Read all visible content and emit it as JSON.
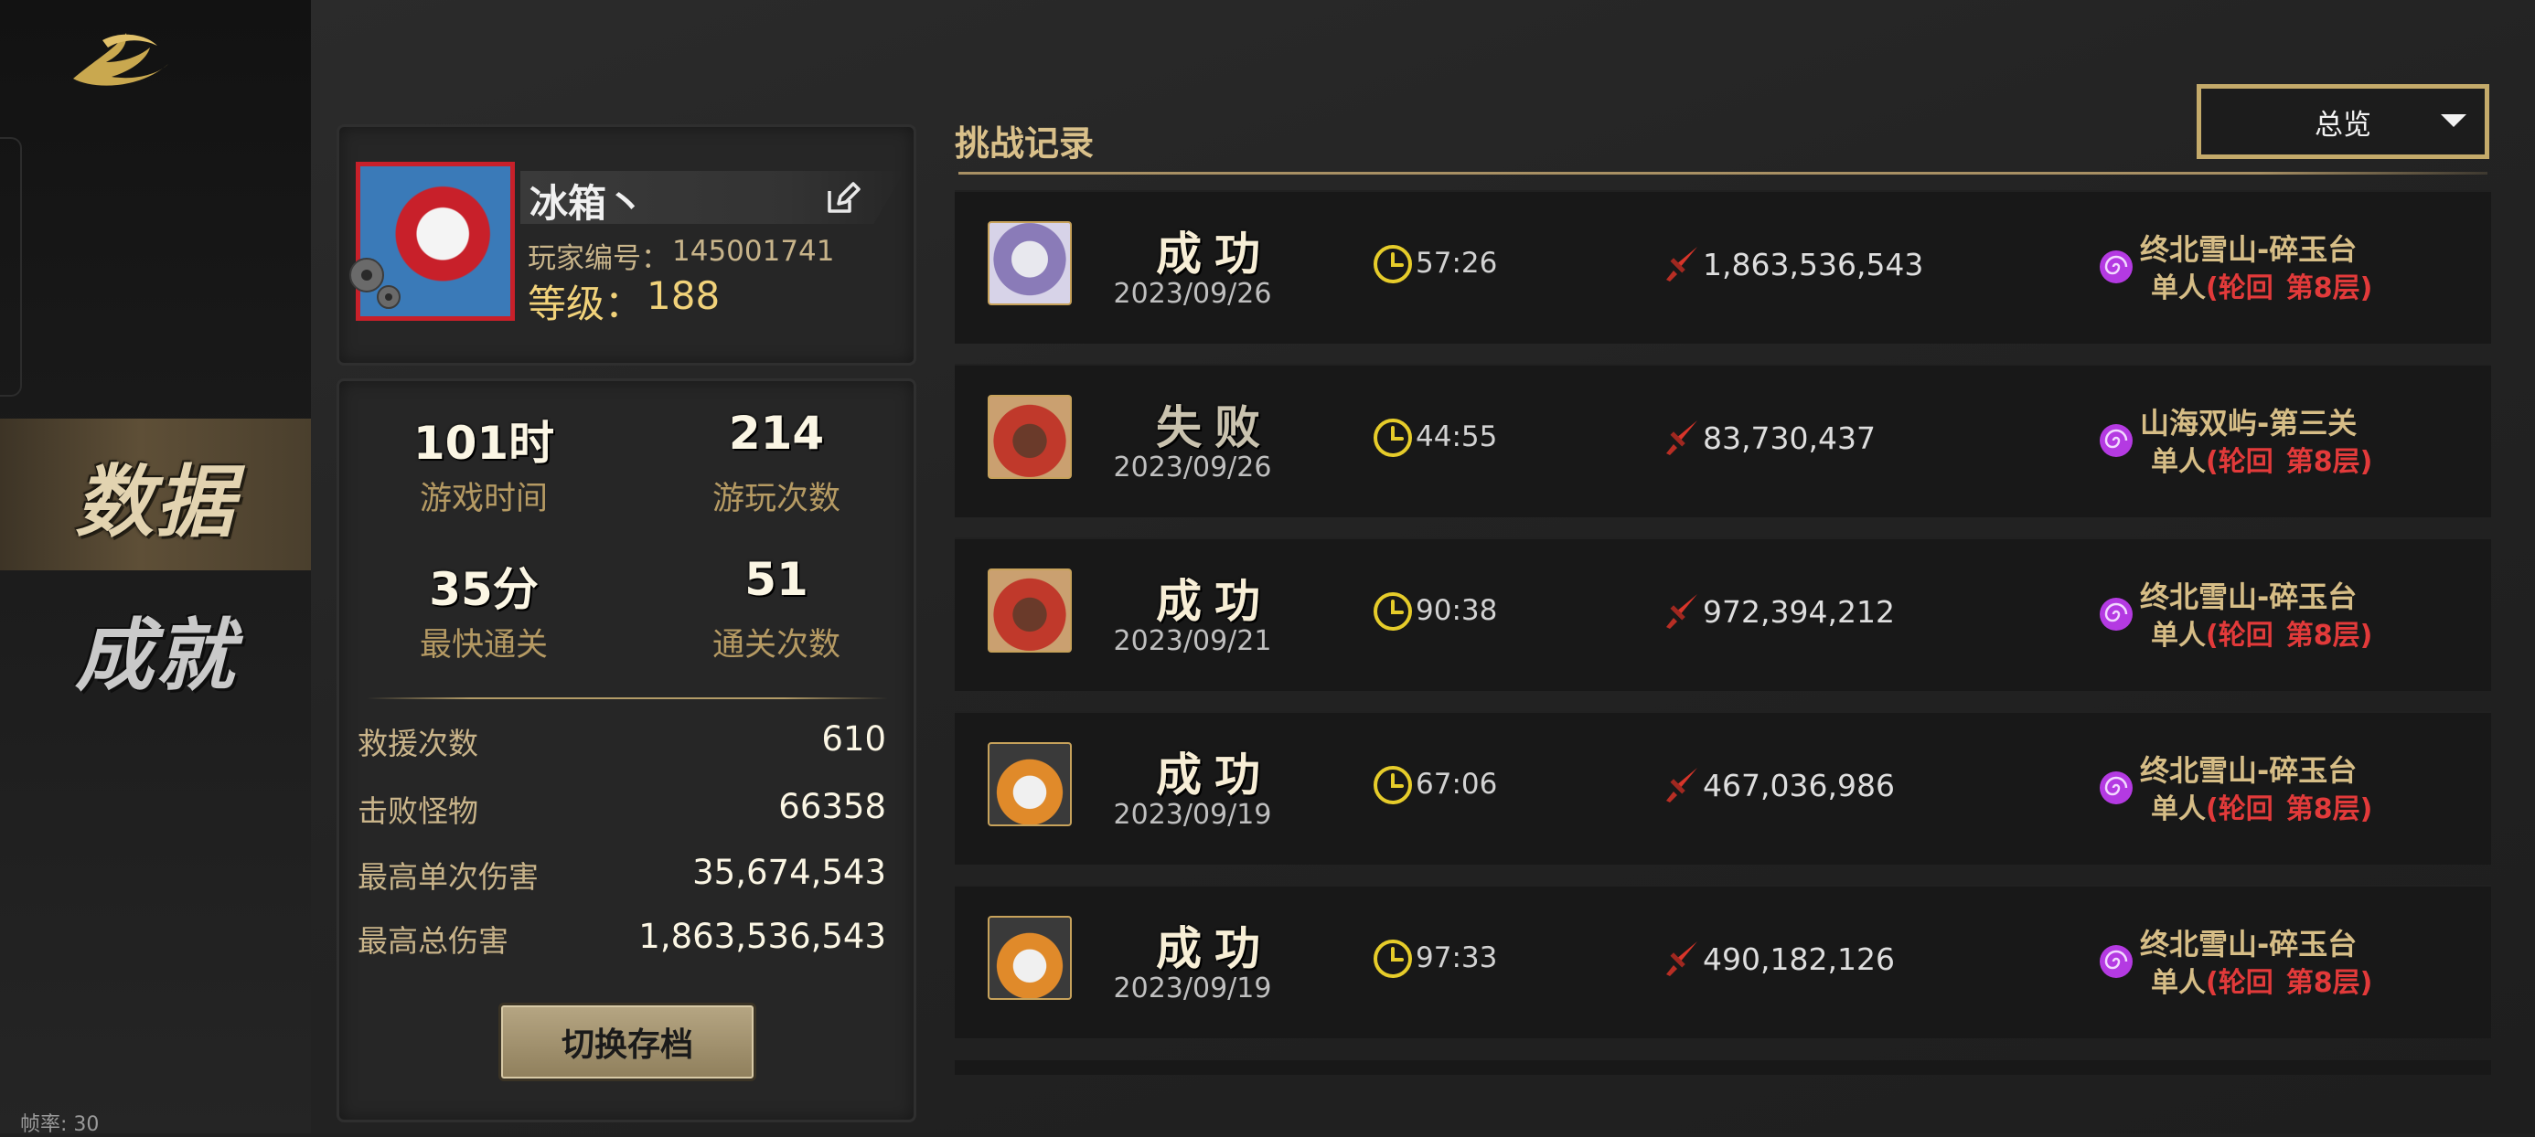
{
  "sidebar": {
    "nav": [
      {
        "label": "数据",
        "active": true
      },
      {
        "label": "成就",
        "active": false
      }
    ],
    "fps": "帧率: 30"
  },
  "profile": {
    "name": "冰箱丶",
    "player_id_label": "玩家编号：",
    "player_id": "145001741",
    "level_label": "等级：",
    "level": "188"
  },
  "stats": {
    "grid": [
      {
        "value": "101时",
        "label": "游戏时间"
      },
      {
        "value": "214",
        "label": "游玩次数"
      },
      {
        "value": "35分",
        "label": "最快通关"
      },
      {
        "value": "51",
        "label": "通关次数"
      }
    ],
    "rows": [
      {
        "label": "救援次数",
        "value": "610"
      },
      {
        "label": "击败怪物",
        "value": "66358"
      },
      {
        "label": "最高单次伤害",
        "value": "35,674,543"
      },
      {
        "label": "最高总伤害",
        "value": "1,863,536,543"
      }
    ],
    "switch_button": "切换存档"
  },
  "challenge": {
    "title": "挑战记录",
    "filter": "总览",
    "records": [
      {
        "result": "成功",
        "date": "2023/09/26",
        "time": "57:26",
        "damage": "1,863,536,543",
        "stage": "终北雪山-碎玉台",
        "mode_prefix": "单人",
        "mode_paren": "(轮回",
        "mode_floor": "第8层)"
      },
      {
        "result": "失败",
        "date": "2023/09/26",
        "time": "44:55",
        "damage": "83,730,437",
        "stage": "山海双屿-第三关",
        "mode_prefix": "单人",
        "mode_paren": "(轮回",
        "mode_floor": "第8层)"
      },
      {
        "result": "成功",
        "date": "2023/09/21",
        "time": "90:38",
        "damage": "972,394,212",
        "stage": "终北雪山-碎玉台",
        "mode_prefix": "单人",
        "mode_paren": "(轮回",
        "mode_floor": "第8层)"
      },
      {
        "result": "成功",
        "date": "2023/09/19",
        "time": "67:06",
        "damage": "467,036,986",
        "stage": "终北雪山-碎玉台",
        "mode_prefix": "单人",
        "mode_paren": "(轮回",
        "mode_floor": "第8层)"
      },
      {
        "result": "成功",
        "date": "2023/09/19",
        "time": "97:33",
        "damage": "490,182,126",
        "stage": "终北雪山-碎玉台",
        "mode_prefix": "单人",
        "mode_paren": "(轮回",
        "mode_floor": "第8层)"
      }
    ]
  },
  "colors": {
    "accent_gold": "#c4aa6a",
    "stat_label": "#b59a63",
    "red": "#e23a3a",
    "swirl": "#b43ae2",
    "clock": "#e6cc2a"
  },
  "icons": [
    "logo",
    "edit-icon",
    "gear-icon",
    "clock-icon",
    "sword-icon",
    "swirl-icon",
    "dropdown-caret-icon"
  ]
}
